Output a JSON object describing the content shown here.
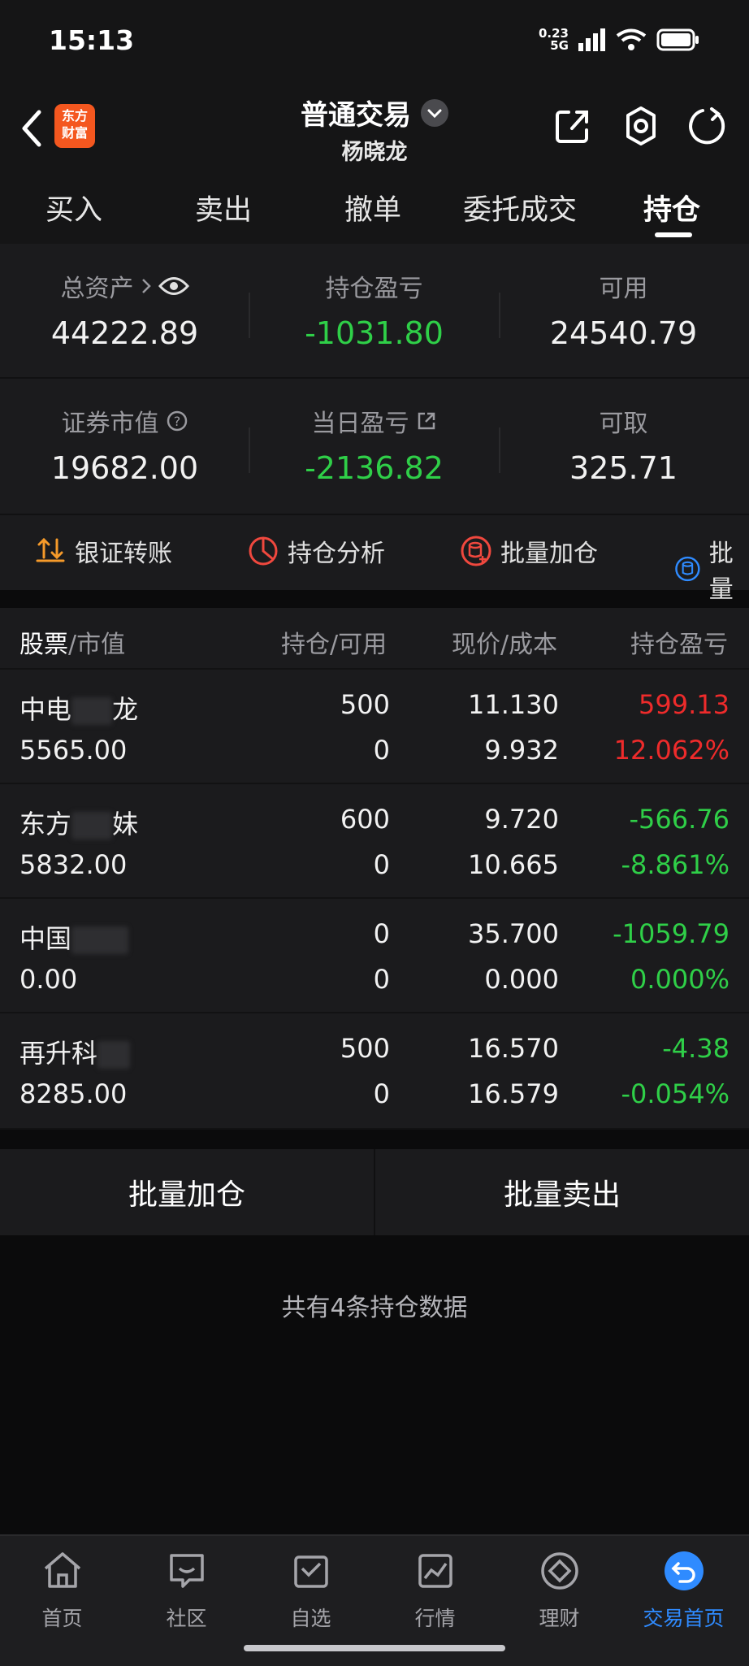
{
  "status_bar": {
    "time": "15:13",
    "net_speed": "0.23",
    "net_type": "5G"
  },
  "header": {
    "title": "普通交易",
    "subtitle": "杨晓龙",
    "logo_line1": "东方",
    "logo_line2": "财富"
  },
  "tabs": [
    {
      "label": "买入"
    },
    {
      "label": "卖出"
    },
    {
      "label": "撤单"
    },
    {
      "label": "委托成交"
    },
    {
      "label": "持仓"
    }
  ],
  "active_tab": "持仓",
  "summary": {
    "total_assets": {
      "label": "总资产",
      "value": "44222.89"
    },
    "position_pl": {
      "label": "持仓盈亏",
      "value": "-1031.80"
    },
    "available": {
      "label": "可用",
      "value": "24540.79"
    },
    "market_value": {
      "label": "证券市值",
      "value": "19682.00"
    },
    "daily_pl": {
      "label": "当日盈亏",
      "value": "-2136.82"
    },
    "withdrawable": {
      "label": "可取",
      "value": "325.71"
    }
  },
  "actions": [
    {
      "label": "银证转账",
      "icon": "transfer-icon"
    },
    {
      "label": "持仓分析",
      "icon": "pie-chart-icon"
    },
    {
      "label": "批量加仓",
      "icon": "database-plus-icon"
    },
    {
      "label": "批量",
      "icon": "database-icon"
    }
  ],
  "table": {
    "headers": {
      "stock": "股票",
      "market_value": "/市值",
      "position": "持仓/可用",
      "price": "现价/成本",
      "pl": "持仓盈亏"
    },
    "rows": [
      {
        "name": "中电",
        "name_tail": "龙",
        "mv": "5565.00",
        "pos": "500",
        "avail": "0",
        "price": "11.130",
        "cost": "9.932",
        "pl": "599.13",
        "pl_pct": "12.062%",
        "dir": "up"
      },
      {
        "name": "东方",
        "name_tail": "妹",
        "mv": "5832.00",
        "pos": "600",
        "avail": "0",
        "price": "9.720",
        "cost": "10.665",
        "pl": "-566.76",
        "pl_pct": "-8.861%",
        "dir": "down"
      },
      {
        "name": "中国",
        "name_tail": "",
        "mv": "0.00",
        "pos": "0",
        "avail": "0",
        "price": "35.700",
        "cost": "0.000",
        "pl": "-1059.79",
        "pl_pct": "0.000%",
        "dir": "down"
      },
      {
        "name": "再升科",
        "name_tail": "",
        "mv": "8285.00",
        "pos": "500",
        "avail": "0",
        "price": "16.570",
        "cost": "16.579",
        "pl": "-4.38",
        "pl_pct": "-0.054%",
        "dir": "down"
      }
    ]
  },
  "buttons": {
    "batch_add": "批量加仓",
    "batch_sell": "批量卖出"
  },
  "footer_note": "共有4条持仓数据",
  "nav": [
    {
      "label": "首页"
    },
    {
      "label": "社区"
    },
    {
      "label": "自选"
    },
    {
      "label": "行情"
    },
    {
      "label": "理财"
    },
    {
      "label": "交易首页"
    }
  ],
  "colors": {
    "up": "#ee2b2b",
    "down": "#2fcf48",
    "accent": "#2f8bff",
    "brand": "#f4571f"
  }
}
